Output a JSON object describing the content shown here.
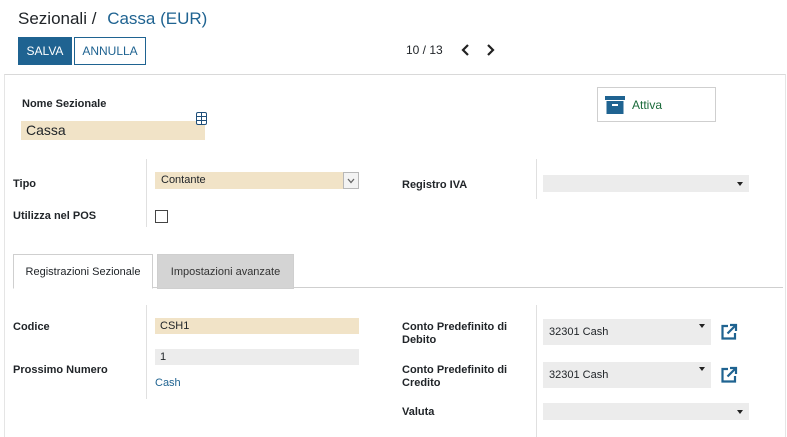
{
  "breadcrumb": {
    "parent": "Sezionali",
    "separator": "/",
    "current": "Cassa (EUR)"
  },
  "toolbar": {
    "save_label": "SALVA",
    "discard_label": "ANNULLA"
  },
  "pager": {
    "value": "10 / 13"
  },
  "form": {
    "name_label": "Nome Sezionale",
    "name_value": "Cassa",
    "status_label": "Attiva",
    "type_label": "Tipo",
    "type_value": "Contante",
    "vat_register_label": "Registro IVA",
    "vat_register_value": "",
    "pos_label": "Utilizza nel POS",
    "pos_checked": false
  },
  "tabs": [
    {
      "label": "Registrazioni Sezionale",
      "active": true
    },
    {
      "label": "Impostazioni avanzate",
      "active": false
    }
  ],
  "entries": {
    "code_label": "Codice",
    "code_value": "CSH1",
    "next_number_label": "Prossimo Numero",
    "next_number_value": "1",
    "sequence_link": "Cash",
    "debit_account_label_l1": "Conto Predefinito di",
    "debit_account_label_l2": "Debito",
    "debit_account_value": "32301 Cash",
    "credit_account_label_l1": "Conto Predefinito di",
    "credit_account_label_l2": "Credito",
    "credit_account_value": "32301 Cash",
    "currency_label": "Valuta",
    "currency_value": ""
  },
  "colors": {
    "primary": "#1f6391",
    "required_bg": "#f1e3c7",
    "active_green": "#1a6a3a"
  }
}
